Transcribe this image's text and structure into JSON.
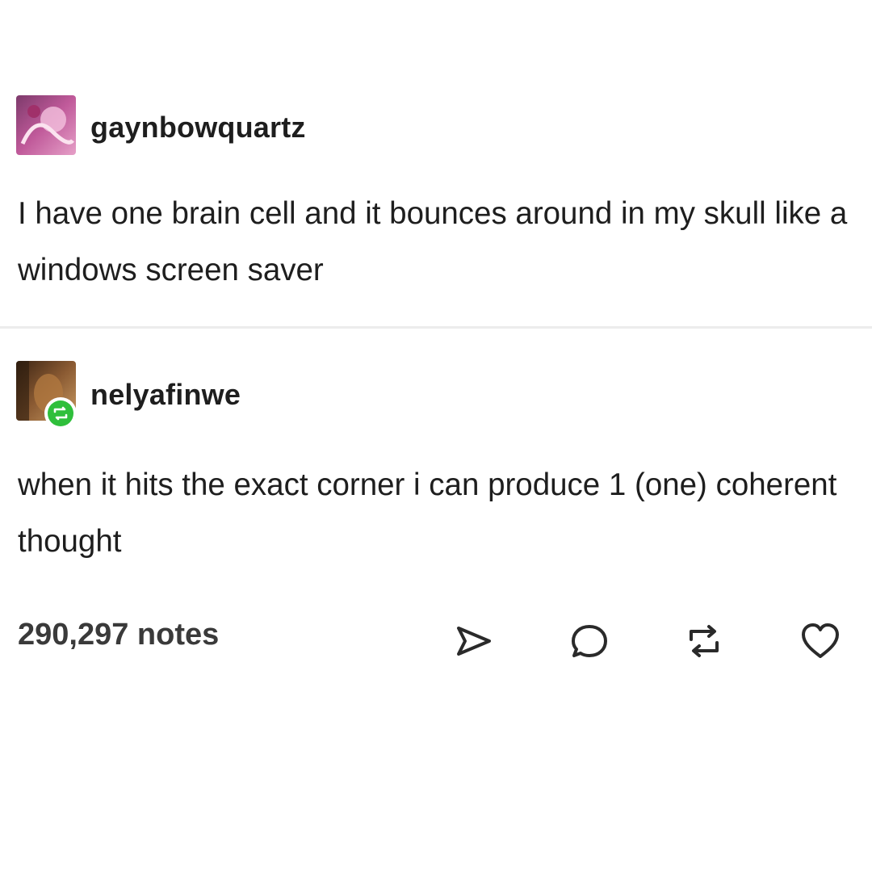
{
  "posts": [
    {
      "username": "gaynbowquartz",
      "text": "I have one brain cell and it bounces around in my skull like a windows screen saver"
    },
    {
      "username": "nelyafinwe",
      "text": "when it hits the exact corner i can produce 1 (one) coherent thought"
    }
  ],
  "footer": {
    "notes": "290,297 notes"
  },
  "actions": [
    "share-icon",
    "reply-icon",
    "reblog-icon",
    "like-icon"
  ],
  "colors": {
    "text": "#1e1e1e",
    "notes_text": "#3a3a3a",
    "reblog_badge": "#2fbf3b",
    "divider": "#ececec"
  }
}
